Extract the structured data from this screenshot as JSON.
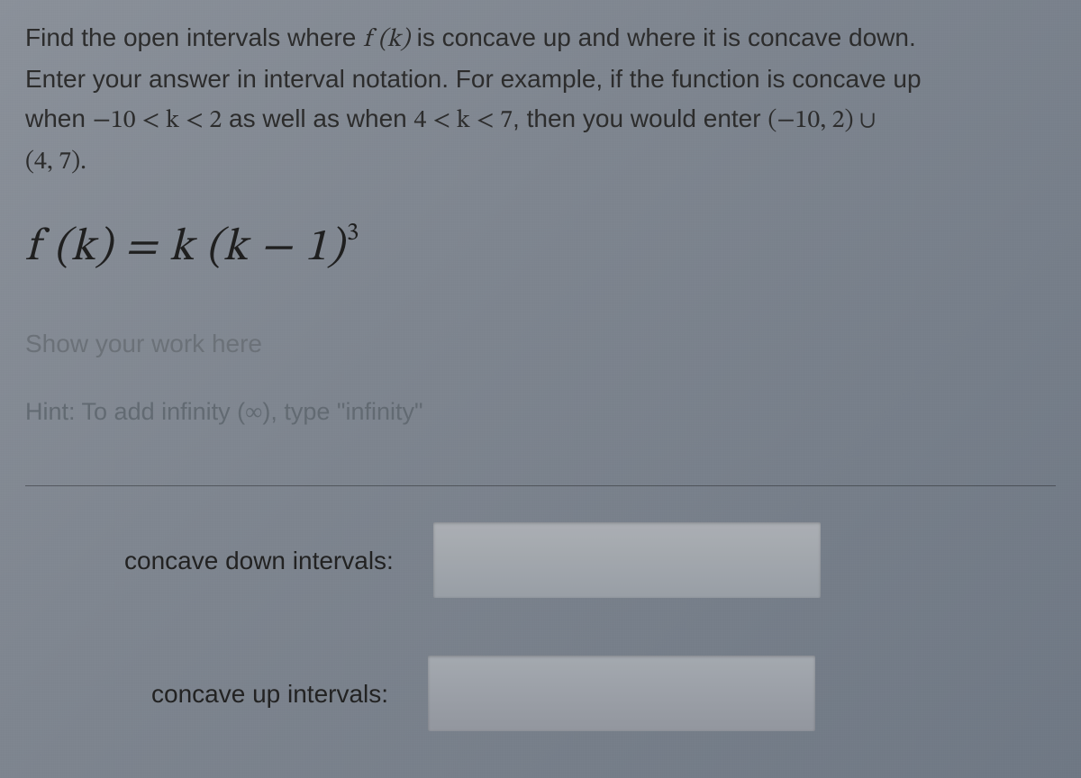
{
  "instructions": {
    "line1_a": "Find the open intervals where ",
    "fk": "f (k)",
    "line1_b": " is concave up and where it is concave down.",
    "line2": "Enter your answer in interval notation. For example, if the function is concave up",
    "line3_a": "when ",
    "cond1": "−10 < k < 2",
    "line3_b": " as well as when ",
    "cond2": "4 < k < 7",
    "line3_c": ", then you would enter ",
    "interval": "(−10, 2) ∪",
    "line4": "(4, 7)."
  },
  "formula": {
    "lhs": "f (k) = k (k − 1)",
    "exp": "3"
  },
  "work_placeholder": "Show your work here",
  "hint": {
    "text_a": "Hint: To add infinity (",
    "inf": "∞",
    "text_b": "), type \"infinity\""
  },
  "labels": {
    "concave_down": "concave down intervals:",
    "concave_up": "concave up intervals:"
  },
  "inputs": {
    "concave_down_value": "",
    "concave_up_value": ""
  }
}
